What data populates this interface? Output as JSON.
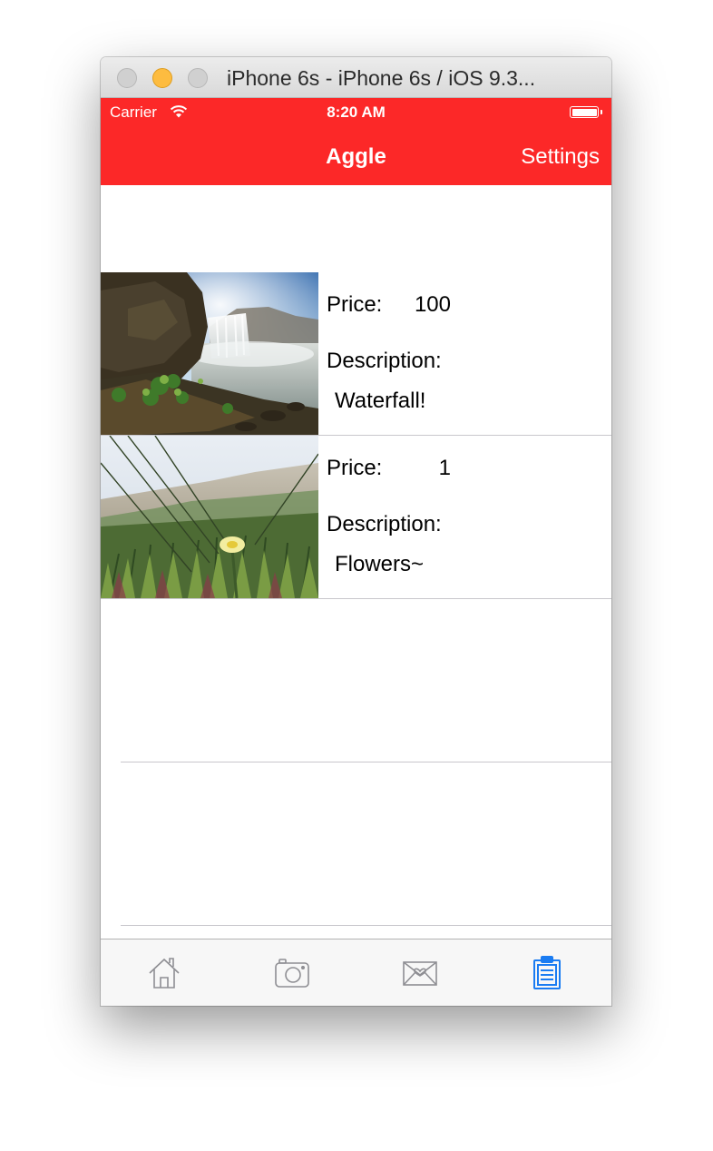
{
  "window": {
    "title": "iPhone 6s - iPhone 6s / iOS 9.3..."
  },
  "status_bar": {
    "carrier": "Carrier",
    "time": "8:20 AM"
  },
  "nav_bar": {
    "title": "Aggle",
    "right_button": "Settings",
    "color": "#fc2828"
  },
  "items": [
    {
      "price_label": "Price:",
      "price": "100",
      "description_label": "Description:",
      "description": "Waterfall!",
      "image": "waterfall-photo"
    },
    {
      "price_label": "Price:",
      "price": "1",
      "description_label": "Description:",
      "description": "Flowers~",
      "image": "flowers-photo"
    }
  ],
  "tab_bar": {
    "tabs": [
      {
        "icon": "home-icon",
        "selected": false
      },
      {
        "icon": "camera-icon",
        "selected": false
      },
      {
        "icon": "mail-heart-icon",
        "selected": false
      },
      {
        "icon": "clipboard-icon",
        "selected": true
      }
    ],
    "selected_color": "#1a7cf2",
    "unselected_color": "#8e8e93"
  }
}
